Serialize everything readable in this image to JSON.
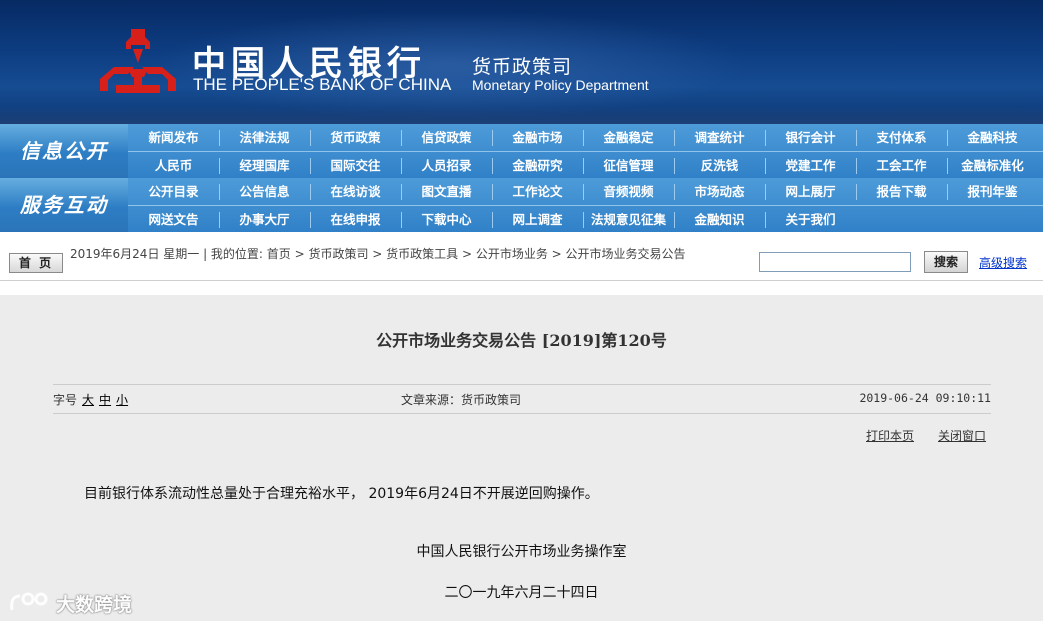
{
  "banner": {
    "cn_name": "中国人民银行",
    "en_name": "THE PEOPLE'S BANK OF CHINA",
    "dept_cn": "货币政策司",
    "dept_en": "Monetary Policy Department",
    "logo_color": "#d7201a"
  },
  "nav": [
    {
      "section": "信息公开",
      "rows": [
        [
          "新闻发布",
          "法律法规",
          "货币政策",
          "信贷政策",
          "金融市场",
          "金融稳定",
          "调查统计",
          "银行会计",
          "支付体系",
          "金融科技"
        ],
        [
          "人民币",
          "经理国库",
          "国际交往",
          "人员招录",
          "金融研究",
          "征信管理",
          "反洗钱",
          "党建工作",
          "工会工作",
          "金融标准化"
        ]
      ]
    },
    {
      "section": "服务互动",
      "rows": [
        [
          "公开目录",
          "公告信息",
          "在线访谈",
          "图文直播",
          "工作论文",
          "音频视频",
          "市场动态",
          "网上展厅",
          "报告下载",
          "报刊年鉴"
        ],
        [
          "网送文告",
          "办事大厅",
          "在线申报",
          "下载中心",
          "网上调查",
          "法规意见征集",
          "金融知识",
          "关于我们"
        ]
      ]
    }
  ],
  "crumb": {
    "home_label": "首 页",
    "text": "2019年6月24日  星期一  |  我的位置: 首页  >  货币政策司  >  货币政策工具  >  公开市场业务  >  公开市场业务交易公告",
    "search_value": "",
    "search_label": "搜索",
    "advanced_label": "高级搜索"
  },
  "article": {
    "title": "公开市场业务交易公告 [2019]第120号",
    "font_label": "字号",
    "font_sizes": [
      "大",
      "中",
      "小"
    ],
    "source": "文章来源：货币政策司",
    "timestamp": "2019-06-24  09:10:11",
    "print_label": "打印本页",
    "close_label": "关闭窗口",
    "body": "目前银行体系流动性总量处于合理充裕水平， 2019年6月24日不开展逆回购操作。",
    "signature": "中国人民银行公开市场业务操作室",
    "date_cn": "二〇一九年六月二十四日"
  },
  "watermark": {
    "text": "大数跨境"
  }
}
